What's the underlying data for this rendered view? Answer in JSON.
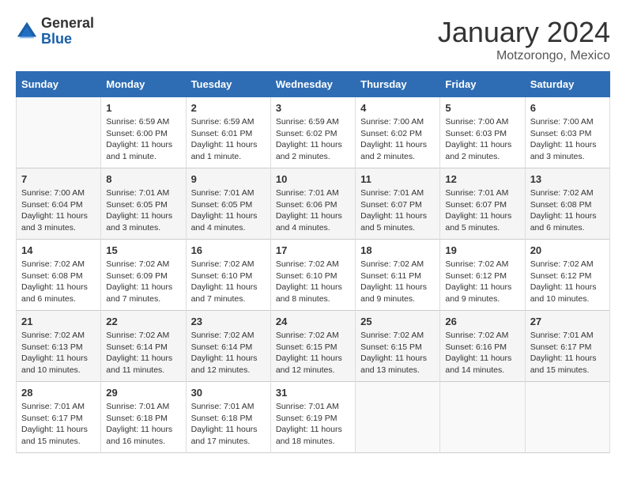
{
  "logo": {
    "general": "General",
    "blue": "Blue"
  },
  "header": {
    "title": "January 2024",
    "subtitle": "Motzorongo, Mexico"
  },
  "weekdays": [
    "Sunday",
    "Monday",
    "Tuesday",
    "Wednesday",
    "Thursday",
    "Friday",
    "Saturday"
  ],
  "weeks": [
    [
      {
        "day": "",
        "sunrise": "",
        "sunset": "",
        "daylight": ""
      },
      {
        "day": "1",
        "sunrise": "Sunrise: 6:59 AM",
        "sunset": "Sunset: 6:00 PM",
        "daylight": "Daylight: 11 hours and 1 minute."
      },
      {
        "day": "2",
        "sunrise": "Sunrise: 6:59 AM",
        "sunset": "Sunset: 6:01 PM",
        "daylight": "Daylight: 11 hours and 1 minute."
      },
      {
        "day": "3",
        "sunrise": "Sunrise: 6:59 AM",
        "sunset": "Sunset: 6:02 PM",
        "daylight": "Daylight: 11 hours and 2 minutes."
      },
      {
        "day": "4",
        "sunrise": "Sunrise: 7:00 AM",
        "sunset": "Sunset: 6:02 PM",
        "daylight": "Daylight: 11 hours and 2 minutes."
      },
      {
        "day": "5",
        "sunrise": "Sunrise: 7:00 AM",
        "sunset": "Sunset: 6:03 PM",
        "daylight": "Daylight: 11 hours and 2 minutes."
      },
      {
        "day": "6",
        "sunrise": "Sunrise: 7:00 AM",
        "sunset": "Sunset: 6:03 PM",
        "daylight": "Daylight: 11 hours and 3 minutes."
      }
    ],
    [
      {
        "day": "7",
        "sunrise": "Sunrise: 7:00 AM",
        "sunset": "Sunset: 6:04 PM",
        "daylight": "Daylight: 11 hours and 3 minutes."
      },
      {
        "day": "8",
        "sunrise": "Sunrise: 7:01 AM",
        "sunset": "Sunset: 6:05 PM",
        "daylight": "Daylight: 11 hours and 3 minutes."
      },
      {
        "day": "9",
        "sunrise": "Sunrise: 7:01 AM",
        "sunset": "Sunset: 6:05 PM",
        "daylight": "Daylight: 11 hours and 4 minutes."
      },
      {
        "day": "10",
        "sunrise": "Sunrise: 7:01 AM",
        "sunset": "Sunset: 6:06 PM",
        "daylight": "Daylight: 11 hours and 4 minutes."
      },
      {
        "day": "11",
        "sunrise": "Sunrise: 7:01 AM",
        "sunset": "Sunset: 6:07 PM",
        "daylight": "Daylight: 11 hours and 5 minutes."
      },
      {
        "day": "12",
        "sunrise": "Sunrise: 7:01 AM",
        "sunset": "Sunset: 6:07 PM",
        "daylight": "Daylight: 11 hours and 5 minutes."
      },
      {
        "day": "13",
        "sunrise": "Sunrise: 7:02 AM",
        "sunset": "Sunset: 6:08 PM",
        "daylight": "Daylight: 11 hours and 6 minutes."
      }
    ],
    [
      {
        "day": "14",
        "sunrise": "Sunrise: 7:02 AM",
        "sunset": "Sunset: 6:08 PM",
        "daylight": "Daylight: 11 hours and 6 minutes."
      },
      {
        "day": "15",
        "sunrise": "Sunrise: 7:02 AM",
        "sunset": "Sunset: 6:09 PM",
        "daylight": "Daylight: 11 hours and 7 minutes."
      },
      {
        "day": "16",
        "sunrise": "Sunrise: 7:02 AM",
        "sunset": "Sunset: 6:10 PM",
        "daylight": "Daylight: 11 hours and 7 minutes."
      },
      {
        "day": "17",
        "sunrise": "Sunrise: 7:02 AM",
        "sunset": "Sunset: 6:10 PM",
        "daylight": "Daylight: 11 hours and 8 minutes."
      },
      {
        "day": "18",
        "sunrise": "Sunrise: 7:02 AM",
        "sunset": "Sunset: 6:11 PM",
        "daylight": "Daylight: 11 hours and 9 minutes."
      },
      {
        "day": "19",
        "sunrise": "Sunrise: 7:02 AM",
        "sunset": "Sunset: 6:12 PM",
        "daylight": "Daylight: 11 hours and 9 minutes."
      },
      {
        "day": "20",
        "sunrise": "Sunrise: 7:02 AM",
        "sunset": "Sunset: 6:12 PM",
        "daylight": "Daylight: 11 hours and 10 minutes."
      }
    ],
    [
      {
        "day": "21",
        "sunrise": "Sunrise: 7:02 AM",
        "sunset": "Sunset: 6:13 PM",
        "daylight": "Daylight: 11 hours and 10 minutes."
      },
      {
        "day": "22",
        "sunrise": "Sunrise: 7:02 AM",
        "sunset": "Sunset: 6:14 PM",
        "daylight": "Daylight: 11 hours and 11 minutes."
      },
      {
        "day": "23",
        "sunrise": "Sunrise: 7:02 AM",
        "sunset": "Sunset: 6:14 PM",
        "daylight": "Daylight: 11 hours and 12 minutes."
      },
      {
        "day": "24",
        "sunrise": "Sunrise: 7:02 AM",
        "sunset": "Sunset: 6:15 PM",
        "daylight": "Daylight: 11 hours and 12 minutes."
      },
      {
        "day": "25",
        "sunrise": "Sunrise: 7:02 AM",
        "sunset": "Sunset: 6:15 PM",
        "daylight": "Daylight: 11 hours and 13 minutes."
      },
      {
        "day": "26",
        "sunrise": "Sunrise: 7:02 AM",
        "sunset": "Sunset: 6:16 PM",
        "daylight": "Daylight: 11 hours and 14 minutes."
      },
      {
        "day": "27",
        "sunrise": "Sunrise: 7:01 AM",
        "sunset": "Sunset: 6:17 PM",
        "daylight": "Daylight: 11 hours and 15 minutes."
      }
    ],
    [
      {
        "day": "28",
        "sunrise": "Sunrise: 7:01 AM",
        "sunset": "Sunset: 6:17 PM",
        "daylight": "Daylight: 11 hours and 15 minutes."
      },
      {
        "day": "29",
        "sunrise": "Sunrise: 7:01 AM",
        "sunset": "Sunset: 6:18 PM",
        "daylight": "Daylight: 11 hours and 16 minutes."
      },
      {
        "day": "30",
        "sunrise": "Sunrise: 7:01 AM",
        "sunset": "Sunset: 6:18 PM",
        "daylight": "Daylight: 11 hours and 17 minutes."
      },
      {
        "day": "31",
        "sunrise": "Sunrise: 7:01 AM",
        "sunset": "Sunset: 6:19 PM",
        "daylight": "Daylight: 11 hours and 18 minutes."
      },
      {
        "day": "",
        "sunrise": "",
        "sunset": "",
        "daylight": ""
      },
      {
        "day": "",
        "sunrise": "",
        "sunset": "",
        "daylight": ""
      },
      {
        "day": "",
        "sunrise": "",
        "sunset": "",
        "daylight": ""
      }
    ]
  ]
}
